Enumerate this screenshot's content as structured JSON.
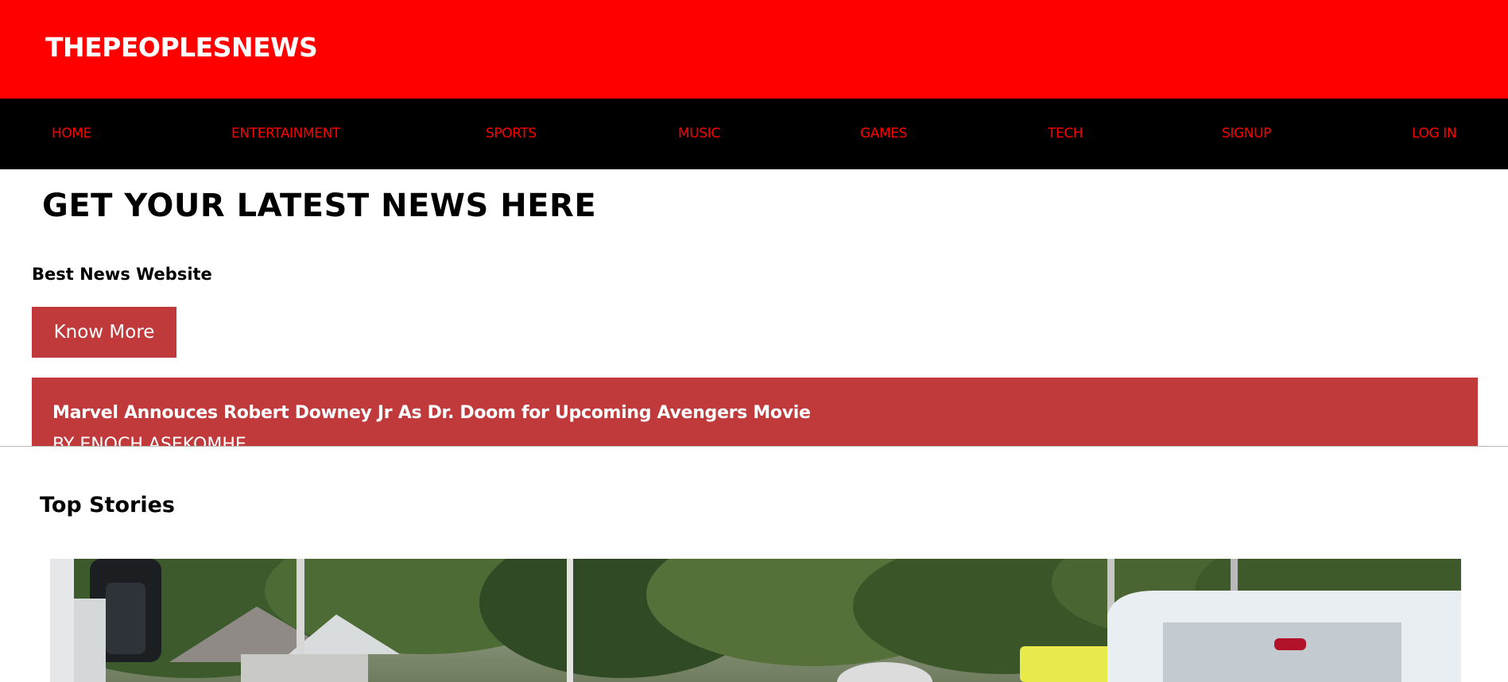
{
  "site": {
    "brand": "THEPEOPLESNEWS",
    "brand_color": "#ff0000"
  },
  "nav": {
    "items": [
      {
        "label": "HOME"
      },
      {
        "label": "ENTERTAINMENT"
      },
      {
        "label": "SPORTS"
      },
      {
        "label": "MUSIC"
      },
      {
        "label": "GAMES"
      },
      {
        "label": "TECH"
      },
      {
        "label": "SIGNUP"
      },
      {
        "label": "LOG IN"
      }
    ],
    "text_color": "#ff0000",
    "background": "#000000"
  },
  "hero": {
    "title": "GET YOUR LATEST NEWS HERE",
    "subtitle": "Best News Website",
    "button_label": "Know More",
    "button_color": "#c0393b"
  },
  "headline": {
    "title": "Marvel Annouces Robert Downey Jr As Dr. Doom for Upcoming Avengers Movie",
    "author": "BY ENOCH ASEKOMHE",
    "panel_color": "#c0393b"
  },
  "top_stories": {
    "heading": "Top Stories",
    "image_subject": "street-scene-photo"
  }
}
